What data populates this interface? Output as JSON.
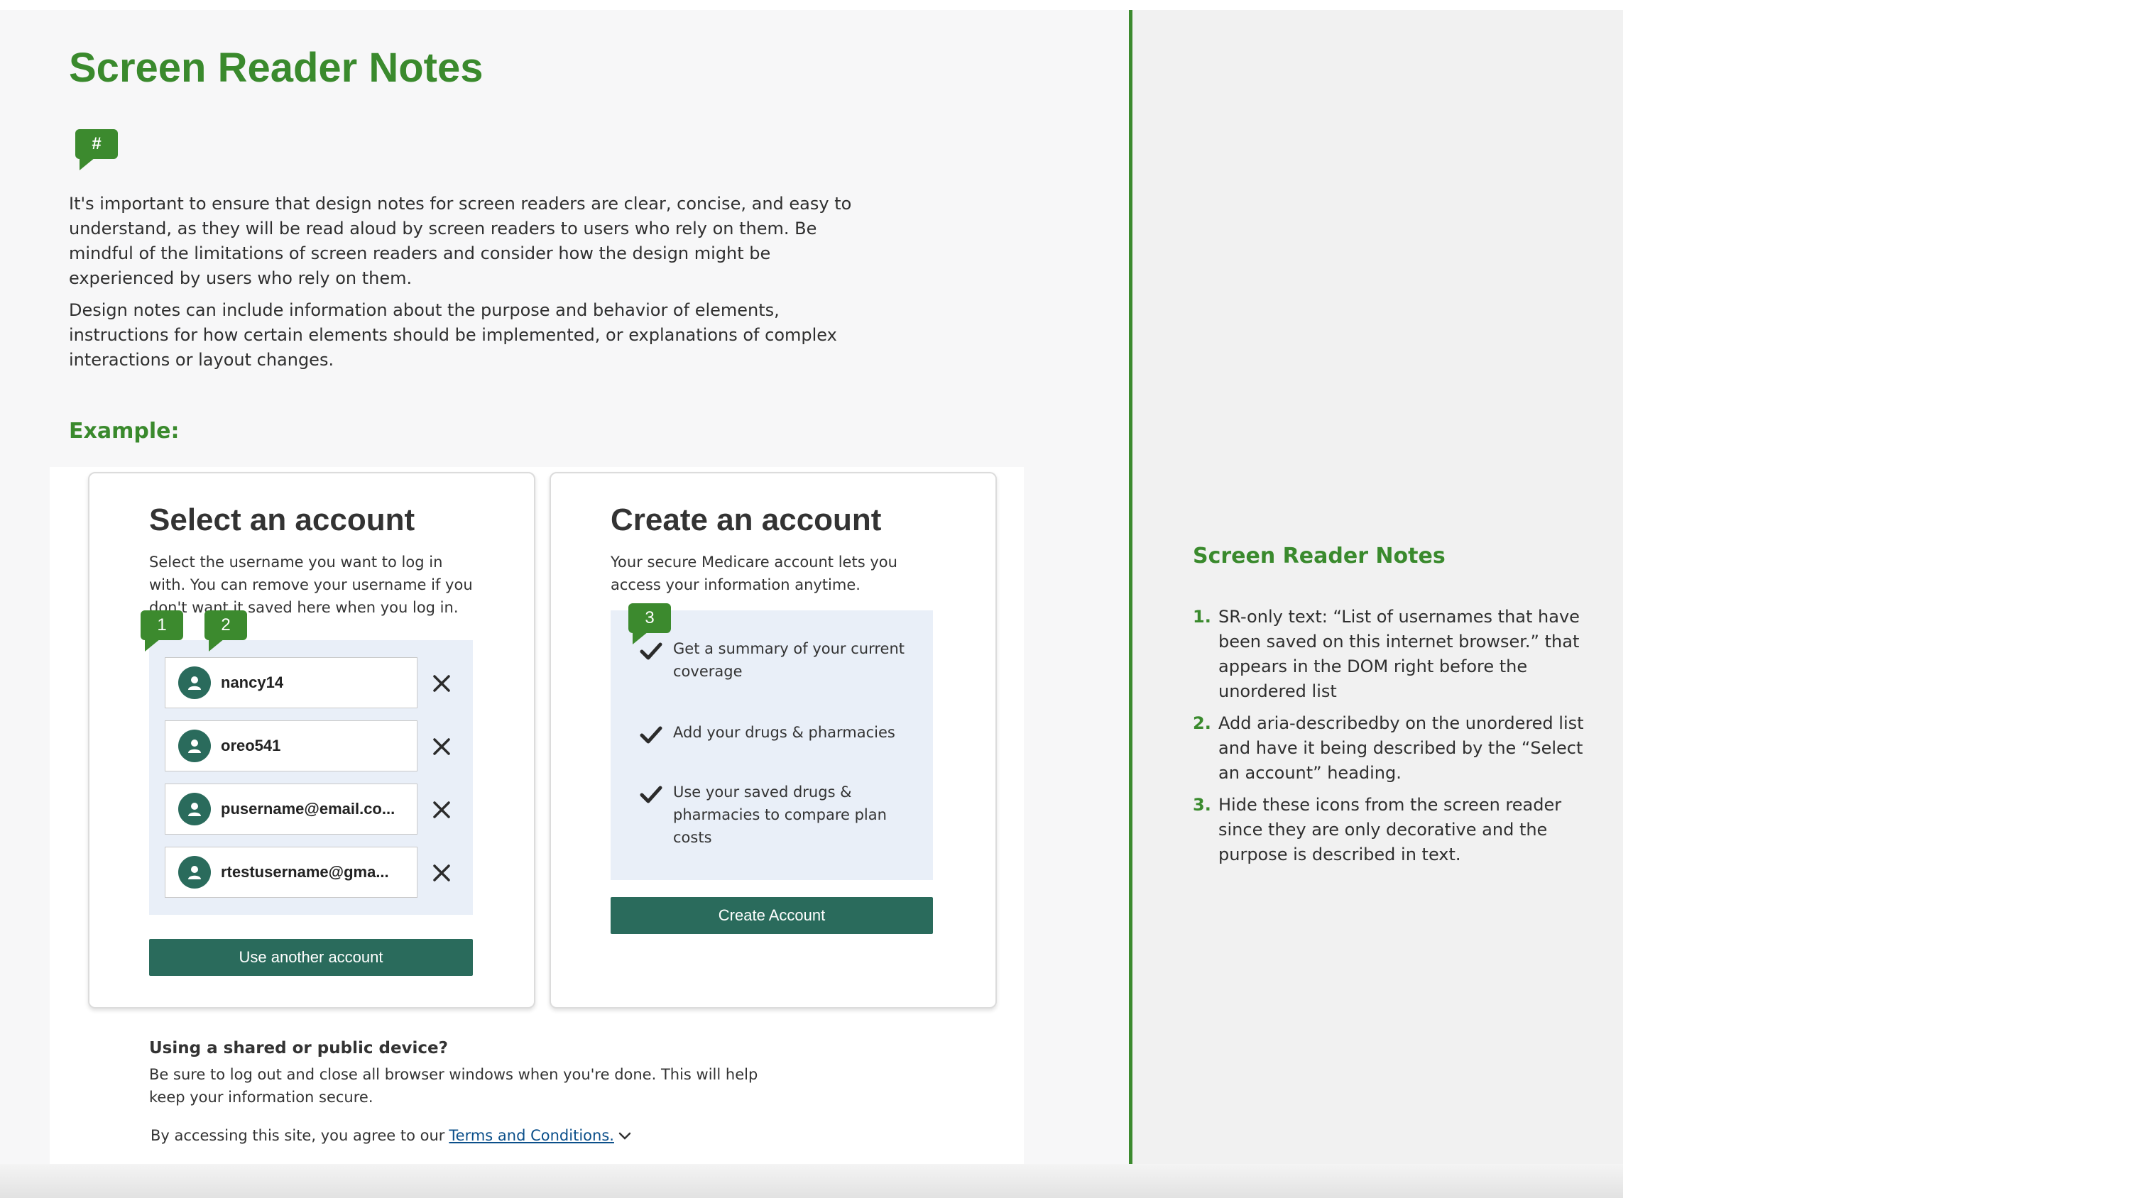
{
  "page": {
    "title": "Screen Reader Notes",
    "hash_marker": "#",
    "intro_paragraphs": [
      "It's important to ensure that design notes for screen readers are clear, concise, and easy to understand, as they will be read aloud by screen readers to users who rely on them. Be mindful of the limitations of screen readers and consider how the design might be experienced by users who rely on them.",
      "Design notes can include information about the purpose and behavior of elements, instructions for how certain elements should be implemented, or explanations of complex interactions or layout changes."
    ],
    "example_label": "Example:"
  },
  "select_card": {
    "title": "Select an account",
    "description": "Select the username you want to log in with. You can remove your username if you don't want it saved here when you log in.",
    "usernames": [
      "nancy14",
      "oreo541",
      "pusername@email.co...",
      "rtestusername@gma..."
    ],
    "button_label": "Use another account"
  },
  "create_card": {
    "title": "Create an account",
    "description": "Your secure Medicare account lets you access your information anytime.",
    "features": [
      "Get a summary of your current coverage",
      "Add your drugs & pharmacies",
      "Use your saved drugs & pharmacies to compare plan costs"
    ],
    "button_label": "Create Account"
  },
  "markers": [
    "1",
    "2",
    "3"
  ],
  "footer": {
    "heading": "Using a shared or public device?",
    "text": "Be sure to log out and close all browser windows when you're done. This will help keep your information secure.",
    "terms_prefix": "By accessing this site, you agree to our",
    "terms_link": "Terms and Conditions."
  },
  "notes": {
    "title": "Screen Reader Notes",
    "items": [
      {
        "num": "1.",
        "text": "SR-only text: “List of usernames that have been saved on this internet browser.” that appears in the DOM right before the unordered list"
      },
      {
        "num": "2.",
        "text": "Add aria-describedby on the unordered list and have it being described by the “Select an account” heading."
      },
      {
        "num": "3.",
        "text": "Hide these icons from the screen reader since they are only decorative and the purpose is described in text."
      }
    ]
  },
  "colors": {
    "brand_green": "#3a8a2d",
    "button_teal": "#2a6b5c",
    "panel_blue": "#e9eff8",
    "link_blue": "#0b4f8a"
  },
  "icons": [
    "hash-marker-icon",
    "user-avatar-icon",
    "close-icon",
    "checkmark-icon",
    "chevron-down-icon"
  ]
}
